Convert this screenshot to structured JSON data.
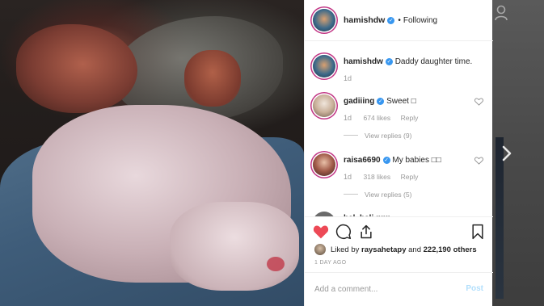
{
  "post": {
    "username": "hamishdw",
    "separator": "•",
    "follow_status": "Following"
  },
  "caption": {
    "username": "hamishdw",
    "text": "Daddy daughter time.",
    "time": "1d"
  },
  "comments": [
    {
      "username": "gadiiing",
      "text": "Sweet □",
      "time": "1d",
      "likes": "674 likes",
      "reply": "Reply",
      "view_replies": "View replies (9)"
    },
    {
      "username": "raisa6690",
      "text": "My babies □□",
      "time": "1d",
      "likes": "318 likes",
      "reply": "Reply",
      "view_replies": "View replies (5)"
    },
    {
      "username": "bel_hali",
      "text": "♥♥♥"
    }
  ],
  "likes": {
    "prefix": "Liked by",
    "user": "raysahetapy",
    "and": "and",
    "count": "222,190 others"
  },
  "time_ago": "1 DAY AGO",
  "add_comment": {
    "placeholder": "Add a comment...",
    "post_label": "Post"
  },
  "colors": {
    "liked_heart": "#ed4956",
    "verified": "#3897f0",
    "post_disabled": "#b2dffc"
  },
  "icons": {
    "profile": "person-icon",
    "next": "chevron-right-icon",
    "like": "heart-filled-icon",
    "comment": "speech-bubble-icon",
    "share": "share-icon",
    "save": "bookmark-icon"
  }
}
